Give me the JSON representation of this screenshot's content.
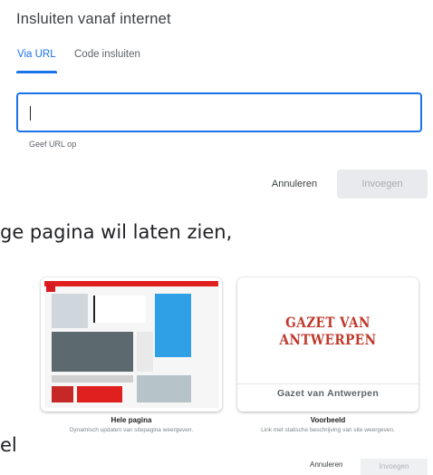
{
  "dialog": {
    "title": "Insluiten vanaf internet",
    "tabs": [
      {
        "label": "Via URL",
        "active": true
      },
      {
        "label": "Code insluiten",
        "active": false
      }
    ],
    "url_input": {
      "value": "",
      "helper": "Geef URL op"
    },
    "cancel_label": "Annuleren",
    "insert_label": "Invoegen"
  },
  "background": {
    "line_1": "ge pagina wil laten zien,",
    "line_2": "el",
    "cards": [
      {
        "title": "Hele pagina",
        "subtitle": "Dynamisch updaten van sitepagina weergeven."
      },
      {
        "title": "Voorbeeld",
        "subtitle": "Link met statische beschrijving van site weergeven.",
        "logo_text": "GAZET VAN ANTWERPEN",
        "name": "Gazet van Antwerpen"
      }
    ],
    "cancel_label": "Annuleren",
    "insert_label": "Invoegen"
  },
  "colors": {
    "accent": "#1a73e8",
    "logo_red": "#c0392b"
  }
}
